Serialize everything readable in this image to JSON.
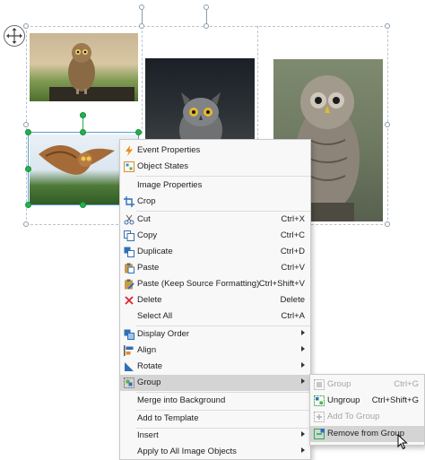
{
  "canvas": {
    "move_icon": "four-way-arrow-icon",
    "photos": [
      "owl-1-photo",
      "owl-2-photo",
      "owl-3-photo",
      "owl-4-photo"
    ]
  },
  "context_menu": {
    "items": [
      {
        "label": "Event Properties",
        "icon": "lightning-icon"
      },
      {
        "label": "Object States",
        "icon": "object-states-icon"
      },
      {
        "label": "Image Properties",
        "icon": ""
      },
      {
        "label": "Crop",
        "icon": "crop-icon"
      },
      {
        "label": "Cut",
        "icon": "scissors-icon",
        "shortcut": "Ctrl+X"
      },
      {
        "label": "Copy",
        "icon": "copy-icon",
        "shortcut": "Ctrl+C"
      },
      {
        "label": "Duplicate",
        "icon": "duplicate-icon",
        "shortcut": "Ctrl+D"
      },
      {
        "label": "Paste",
        "icon": "paste-icon",
        "shortcut": "Ctrl+V"
      },
      {
        "label": "Paste (Keep Source Formatting)",
        "icon": "paste-format-icon",
        "shortcut": "Ctrl+Shift+V"
      },
      {
        "label": "Delete",
        "icon": "delete-x-icon",
        "shortcut": "Delete"
      },
      {
        "label": "Select All",
        "icon": "",
        "shortcut": "Ctrl+A"
      },
      {
        "label": "Display Order",
        "icon": "display-order-icon",
        "submenu": true
      },
      {
        "label": "Align",
        "icon": "align-icon",
        "submenu": true
      },
      {
        "label": "Rotate",
        "icon": "rotate-icon",
        "submenu": true
      },
      {
        "label": "Group",
        "icon": "group-icon",
        "submenu": true,
        "highlighted": true
      },
      {
        "label": "Merge into Background",
        "icon": ""
      },
      {
        "label": "Add to Template",
        "icon": ""
      },
      {
        "label": "Insert",
        "icon": "",
        "submenu": true
      },
      {
        "label": "Apply to All Image Objects",
        "icon": "",
        "submenu": true
      }
    ]
  },
  "group_submenu": {
    "items": [
      {
        "label": "Group",
        "shortcut": "Ctrl+G",
        "disabled": true
      },
      {
        "label": "Ungroup",
        "shortcut": "Ctrl+Shift+G",
        "disabled": false
      },
      {
        "label": "Add To Group",
        "shortcut": "",
        "disabled": true
      },
      {
        "label": "Remove from Group",
        "shortcut": "",
        "disabled": false,
        "highlighted": true
      }
    ]
  },
  "colors": {
    "accent_green": "#22b24c",
    "menu_highlight": "#d4d4d4",
    "delete_red": "#d9262b",
    "event_orange": "#f08a1c"
  }
}
